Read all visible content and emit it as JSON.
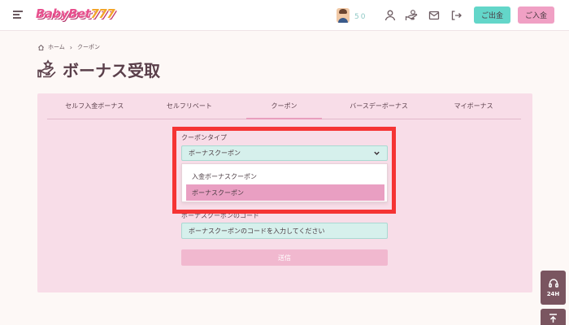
{
  "header": {
    "logo_text_a": "BabyBet",
    "logo_text_b": "777",
    "points": "50",
    "withdraw_label": "ご出金",
    "deposit_label": "ご入金",
    "icons": [
      "menu-icon",
      "user-icon",
      "hand-coin-icon",
      "mail-icon",
      "logout-icon"
    ]
  },
  "breadcrumb": {
    "home": "ホーム",
    "current": "クーポン"
  },
  "page": {
    "title": "ボーナス受取"
  },
  "tabs": [
    {
      "label": "セルフ入金ボーナス",
      "active": false
    },
    {
      "label": "セルフリベート",
      "active": false
    },
    {
      "label": "クーポン",
      "active": true
    },
    {
      "label": "バースデーボーナス",
      "active": false
    },
    {
      "label": "マイボーナス",
      "active": false
    }
  ],
  "form": {
    "coupon_type_label": "クーポンタイプ",
    "coupon_type_value": "ボーナスクーポン",
    "options": [
      {
        "label": "入金ボーナスクーポン",
        "selected": false
      },
      {
        "label": "ボーナスクーポン",
        "selected": true
      }
    ],
    "code_label": "ボーナスクーポンのコード",
    "code_placeholder": "ボーナスクーポンのコードを入力してください",
    "submit_label": "送信"
  },
  "widgets": {
    "support_label": "24H"
  },
  "colors": {
    "accent_teal": "#63d6c9",
    "accent_pink": "#f0a0c4",
    "panel_bg": "#f8dde8",
    "highlight_red": "#f53434"
  }
}
